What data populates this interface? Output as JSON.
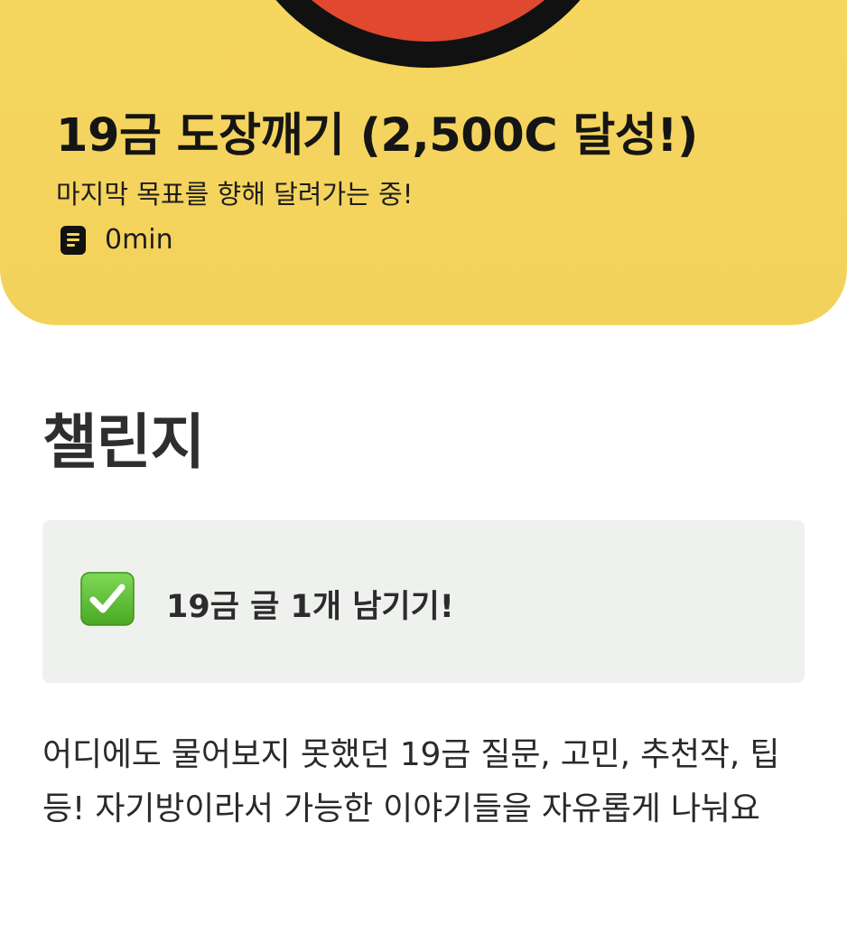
{
  "hero": {
    "title": "19금 도장깨기 (2,500C 달성!)",
    "subtitle": "마지막 목표를 향해 달려가는 중!",
    "reading_time": "0min",
    "reading_time_icon": "document-icon",
    "background_color": "#f4d45e",
    "illustration_colors": {
      "fill": "#e0492f",
      "outline": "#111111"
    }
  },
  "section": {
    "title": "챌린지"
  },
  "callout": {
    "icon": "check-mark-button-icon",
    "icon_color": "#5cbf2a",
    "text": "19금 글 1개 남기기!",
    "background_color": "#eef1ed"
  },
  "body": {
    "paragraph": "어디에도 물어보지 못했던 19금 질문, 고민, 추천작, 팁 등! 자기방이라서 가능한 이야기들을 자유롭게 나눠요"
  }
}
